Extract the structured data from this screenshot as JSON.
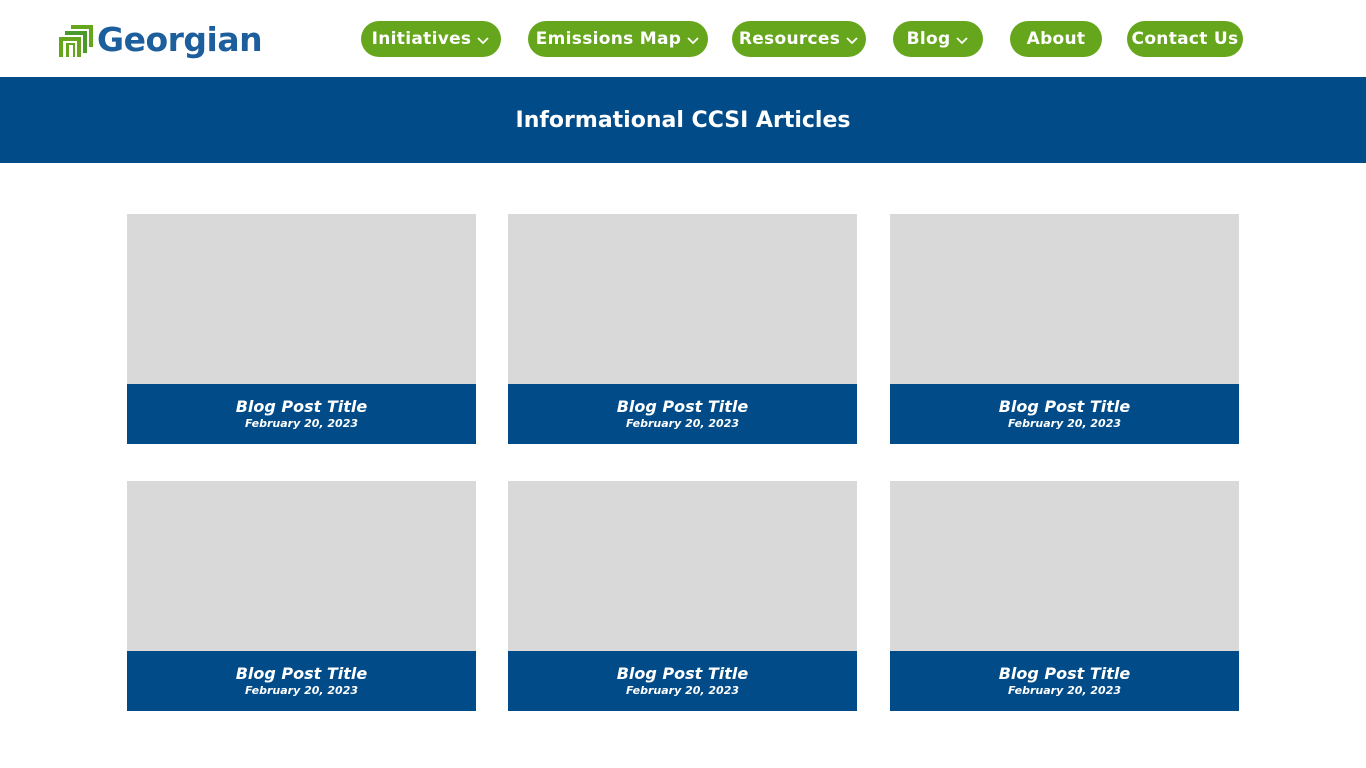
{
  "header": {
    "logo_text": "Georgian",
    "nav": [
      {
        "label": "Initiatives",
        "dropdown": true
      },
      {
        "label": "Emissions Map",
        "dropdown": true
      },
      {
        "label": "Resources",
        "dropdown": true
      },
      {
        "label": "Blog",
        "dropdown": true
      },
      {
        "label": "About",
        "dropdown": false
      },
      {
        "label": "Contact Us",
        "dropdown": false
      }
    ]
  },
  "banner": {
    "title": "Informational CCSI Articles"
  },
  "posts": [
    {
      "title": "Blog Post Title",
      "date": "February 20, 2023"
    },
    {
      "title": "Blog Post Title",
      "date": "February 20, 2023"
    },
    {
      "title": "Blog Post Title",
      "date": "February 20, 2023"
    },
    {
      "title": "Blog Post Title",
      "date": "February 20, 2023"
    },
    {
      "title": "Blog Post Title",
      "date": "February 20, 2023"
    },
    {
      "title": "Blog Post Title",
      "date": "February 20, 2023"
    }
  ],
  "colors": {
    "nav_green": "#66a61c",
    "brand_blue": "#004b88",
    "logo_blue": "#1d5e9c",
    "placeholder_gray": "#d9d9d9"
  }
}
